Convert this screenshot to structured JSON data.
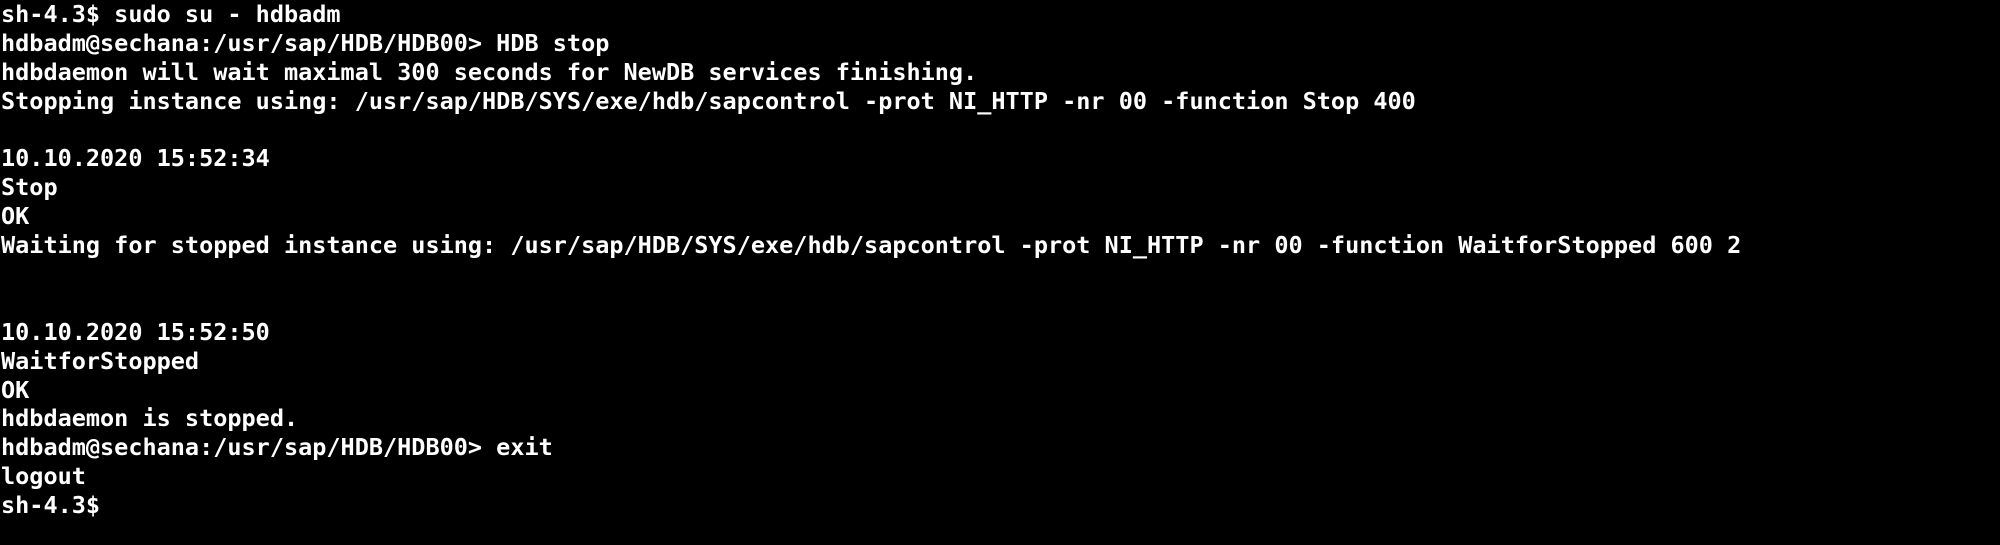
{
  "terminal": {
    "background": "#000000",
    "foreground": "#ffffff",
    "lines": [
      "sh-4.3$ sudo su - hdbadm",
      "hdbadm@sechana:/usr/sap/HDB/HDB00> HDB stop",
      "hdbdaemon will wait maximal 300 seconds for NewDB services finishing.",
      "Stopping instance using: /usr/sap/HDB/SYS/exe/hdb/sapcontrol -prot NI_HTTP -nr 00 -function Stop 400",
      "",
      "10.10.2020 15:52:34",
      "Stop",
      "OK",
      "Waiting for stopped instance using: /usr/sap/HDB/SYS/exe/hdb/sapcontrol -prot NI_HTTP -nr 00 -function WaitforStopped 600 2",
      "",
      "",
      "10.10.2020 15:52:50",
      "WaitforStopped",
      "OK",
      "hdbdaemon is stopped.",
      "hdbadm@sechana:/usr/sap/HDB/HDB00> exit",
      "logout",
      "sh-4.3$"
    ]
  }
}
